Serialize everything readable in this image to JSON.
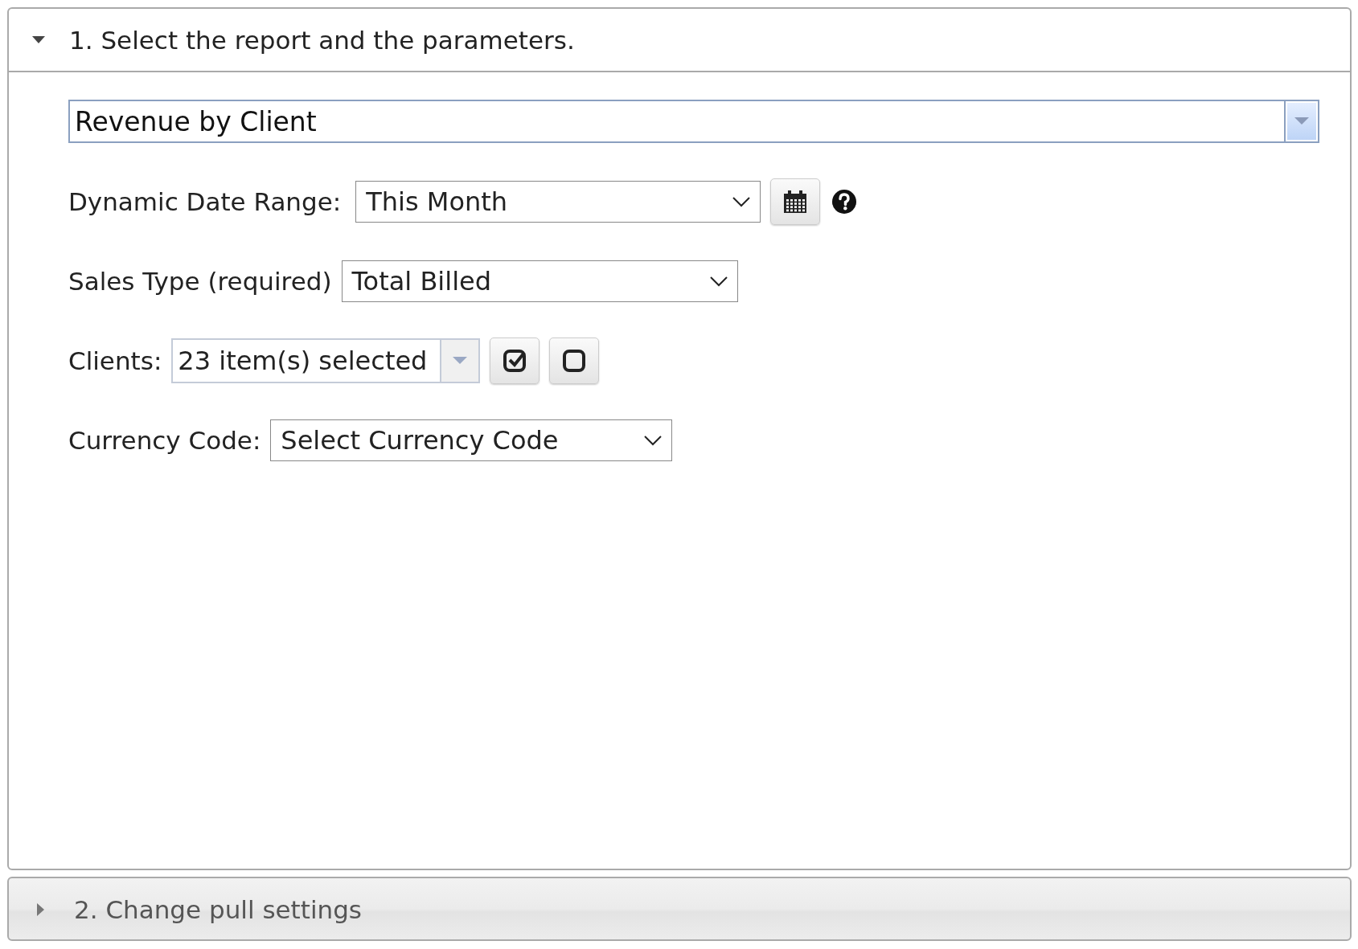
{
  "panels": [
    {
      "title": "1. Select the report and the parameters.",
      "expanded": true,
      "report": {
        "value": "Revenue by Client"
      },
      "parameters": [
        {
          "kind": "daterange",
          "label": "Dynamic Date Range:",
          "value": "This Month"
        },
        {
          "kind": "select",
          "label": "Sales Type (required)",
          "value": "Total Billed"
        },
        {
          "kind": "multiselect",
          "label": "Clients:",
          "value": "23 item(s) selected"
        },
        {
          "kind": "select",
          "label": "Currency Code:",
          "value": "Select Currency Code"
        }
      ]
    },
    {
      "title": "2. Change pull settings",
      "expanded": false
    }
  ]
}
